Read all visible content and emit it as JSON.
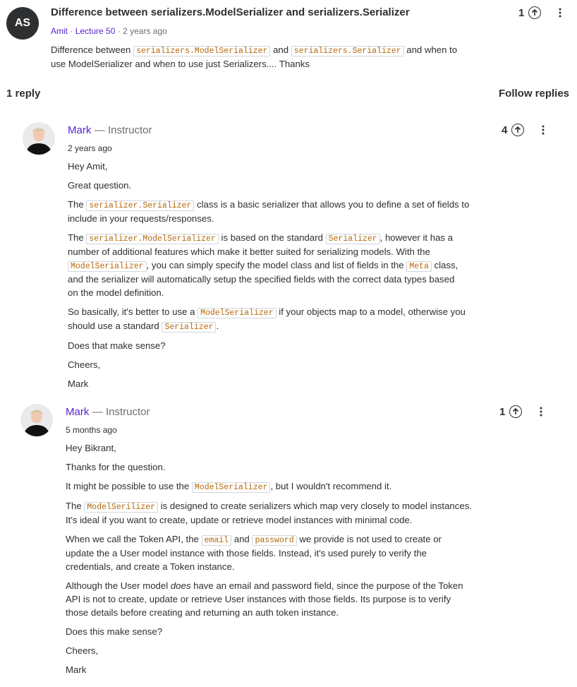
{
  "question": {
    "avatar_initials": "AS",
    "title": "Difference between serializers.ModelSerializer and serializers.Serializer",
    "author": "Amit",
    "lecture": "Lecture 50",
    "time": "2 years ago",
    "votes": "1",
    "body": {
      "t1": "Difference between",
      "c1": "serializers.ModelSerializer",
      "t2": "and",
      "c2": "serializers.Serializer",
      "t3": "and when to",
      "line2": "use ModelSerializer and when to use just Serializers.... Thanks"
    }
  },
  "replies_header": {
    "count_label": "1 reply",
    "follow_label": "Follow replies"
  },
  "reply1": {
    "name": "Mark",
    "role": "— Instructor",
    "time": "2 years ago",
    "votes": "4",
    "greeting": "Hey Amit,",
    "p1": "Great question.",
    "p2": {
      "a": "The",
      "code1": "serializer.Serializer",
      "b": "class is a basic serializer that allows you to define a set of fields to",
      "line2": "include in your requests/responses."
    },
    "p3": {
      "a": "The",
      "code1": "serializer.ModelSerializer",
      "b": "is based on the standard",
      "code2": "Serializer",
      "c": ", however it has a",
      "line2": "number of additional features which make it better suited for serializing models. With the",
      "code3": "ModelSerializer",
      "d": ", you can simply specify the model class and list of fields in the",
      "code4": "Meta",
      "e": "class,",
      "line4": "and the serializer will automatically setup the specified fields with the correct data types based",
      "line5": "on the model definition."
    },
    "p4": {
      "a": "So basically, it's better to use a",
      "code1": "ModelSerializer",
      "b": "if your objects map to a model, otherwise you",
      "c": "should use a standard",
      "code2": "Serializer",
      "d": "."
    },
    "p5": "Does that make sense?",
    "p6": "Cheers,",
    "p7": "Mark"
  },
  "reply2": {
    "name": "Mark",
    "role": "— Instructor",
    "time": "5 months ago",
    "votes": "1",
    "greeting": "Hey Bikrant,",
    "p1": "Thanks for the question.",
    "p2": {
      "a": "It might be possible to use the",
      "code1": "ModelSerializer",
      "b": ", but I wouldn't recommend it."
    },
    "p3": {
      "a": "The",
      "code1": "ModelSerilizer",
      "b": "is designed to create serializers which map very closely to model instances.",
      "line2": "It's ideal if you want to create, update or retrieve model instances with minimal code."
    },
    "p4": {
      "a": "When we call the Token API, the",
      "code1": "email",
      "b": "and",
      "code2": "password",
      "c": "we provide is not used to create or",
      "line2": "update the a User model instance with those fields. Instead, it's used purely to verify the",
      "line3": "credentials, and create a Token instance."
    },
    "p5": {
      "a": "Although the User model",
      "em": "does",
      "b": "have an email and password field, since the purpose of the Token",
      "line2": "API is not to create, update or retrieve User instances with those fields. Its purpose is to verify",
      "line3": "those details before creating and returning an auth token instance."
    },
    "p6": "Does this make sense?",
    "p7": "Cheers,",
    "p8": "Mark"
  },
  "icons": {
    "upvote": "arrow-up-circle-icon",
    "more": "more-vertical-icon"
  },
  "colors": {
    "instructor_name": "#5624d0",
    "code_text": "#b4690e",
    "avatar_bg": "#2d2f31"
  }
}
